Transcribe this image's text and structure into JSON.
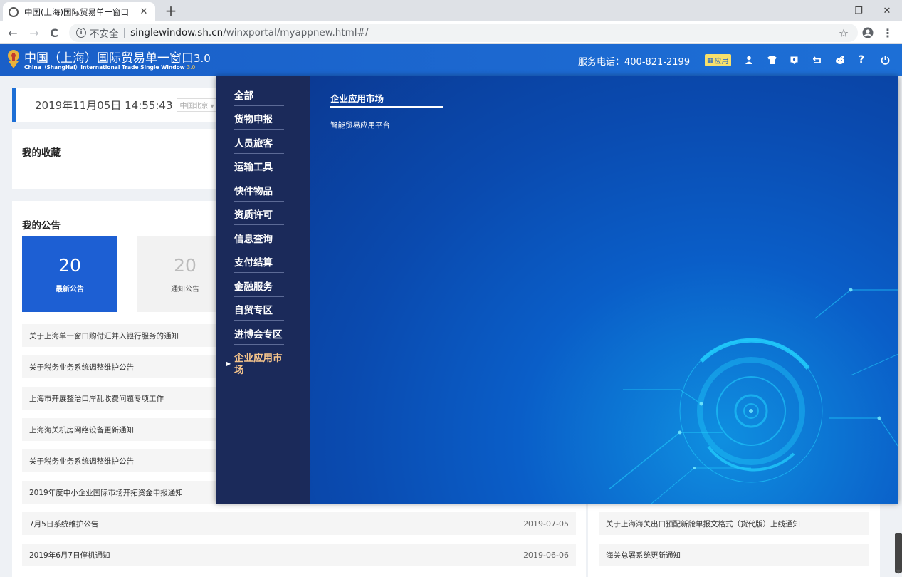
{
  "browser": {
    "tab_title": "中国(上海)国际贸易单一窗口",
    "tab_close": "✕",
    "new_tab": "+",
    "minimize": "—",
    "restore": "❐",
    "close": "✕",
    "back": "←",
    "forward": "→",
    "reload": "C",
    "info": "i",
    "insecure_label": "不安全",
    "separator": "|",
    "url_host": "singlewindow.sh.cn",
    "url_path": "/winxportal/myappnew.html#/",
    "star": "☆",
    "menu": "⋮"
  },
  "header": {
    "title": "中国（上海）国际贸易单一窗口",
    "version": "3.0",
    "subtitle": "China（ShangHai）International  Trade Single  Window",
    "subtitle_version": "3.0",
    "hotline": "服务电话：400-821-2199",
    "app_badge_label": "应用",
    "icons": [
      "user-icon",
      "shirt-icon",
      "notification-icon",
      "return-icon",
      "robot-icon",
      "help-icon",
      "power-icon"
    ]
  },
  "dashboard": {
    "datetime": "2019年11月05日 14:55:43",
    "timezone": "中国北京",
    "favorites_title": "我的收藏",
    "notices_title": "我的公告",
    "stats": [
      {
        "value": "20",
        "label": "最新公告"
      },
      {
        "value": "20",
        "label": "通知公告"
      }
    ],
    "news_left": [
      {
        "title": "关于上海单一窗口购付汇并入银行服务的通知",
        "date": ""
      },
      {
        "title": "关于税务业务系统调整维护公告",
        "date": ""
      },
      {
        "title": "上海市开展整治口岸乱收费问题专项工作",
        "date": ""
      },
      {
        "title": "上海海关机房网络设备更新通知",
        "date": ""
      },
      {
        "title": "关于税务业务系统调整维护公告",
        "date": ""
      },
      {
        "title": "2019年度中小企业国际市场开拓资金申报通知",
        "date": ""
      },
      {
        "title": "7月5日系统维护公告",
        "date": "2019-07-05"
      },
      {
        "title": "2019年6月7日停机通知",
        "date": "2019-06-06"
      }
    ],
    "news_right": [
      {
        "title": "关于上海海关出口预配新舱单报文格式（货代版）上线通知"
      },
      {
        "title": "海关总署系统更新通知"
      }
    ]
  },
  "mega_menu": {
    "categories": [
      "全部",
      "货物申报",
      "人员旅客",
      "运输工具",
      "快件物品",
      "资质许可",
      "信息查询",
      "支付结算",
      "金融服务",
      "自贸专区",
      "进博会专区",
      "企业应用市场"
    ],
    "active_index": 11,
    "section_title": "企业应用市场",
    "links": [
      "智能贸易应用平台"
    ]
  },
  "colors": {
    "brand_blue": "#1d6fd6",
    "menu_dark": "#1b2a5a",
    "active_orange": "#f6c58c",
    "badge_yellow": "#f7e06b"
  }
}
